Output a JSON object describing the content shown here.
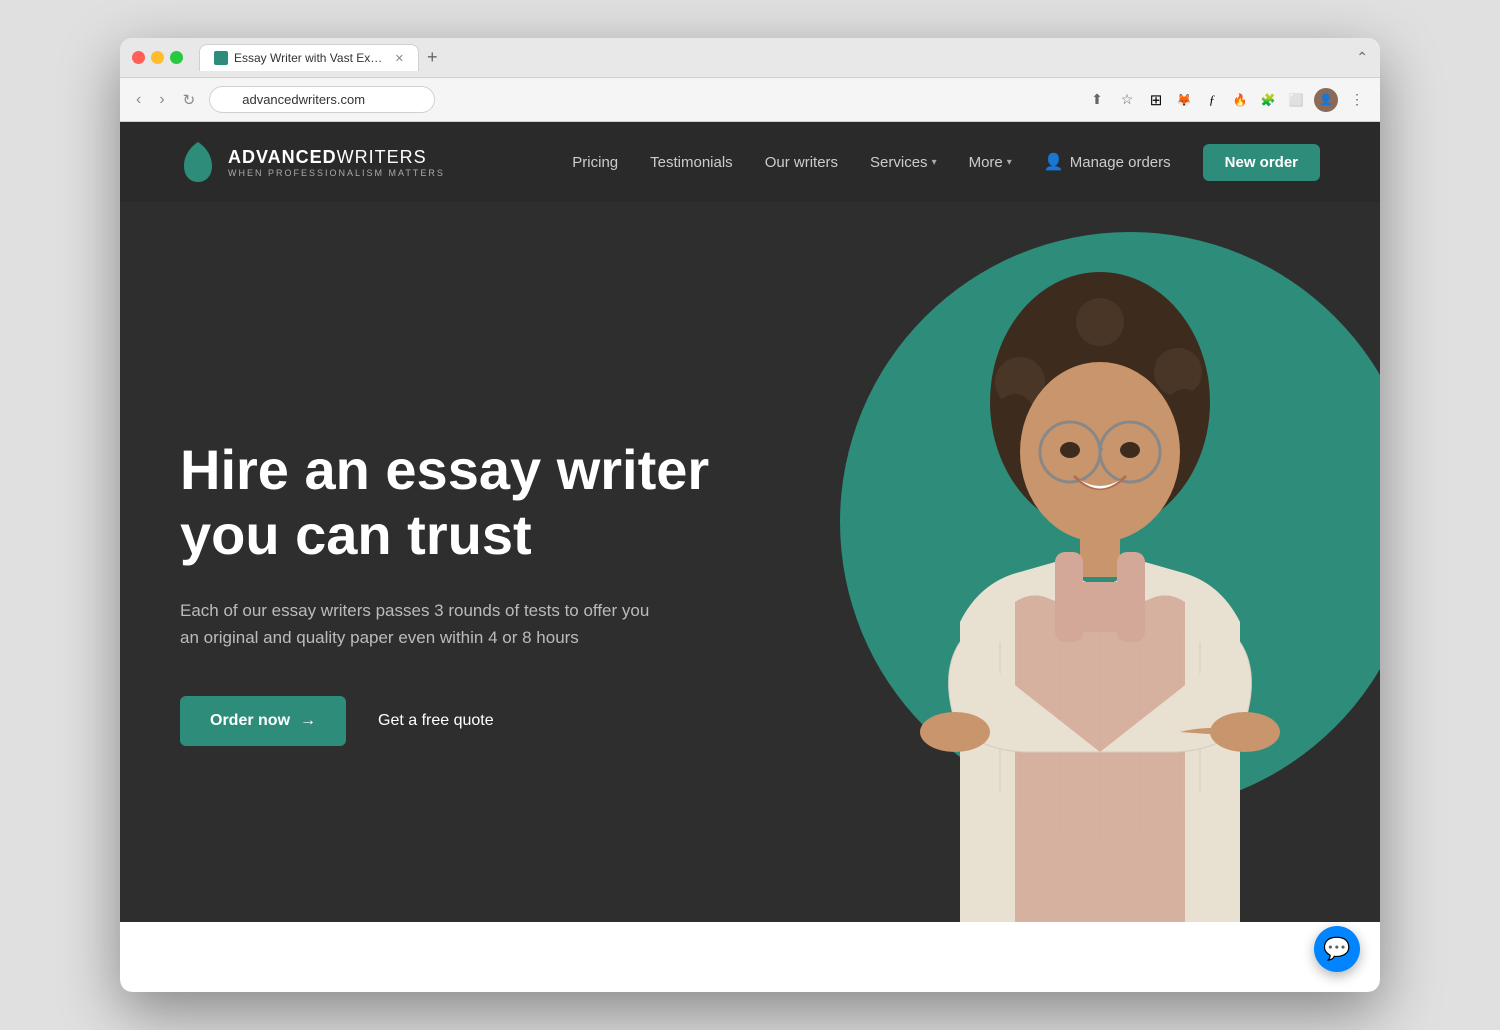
{
  "browser": {
    "tab_title": "Essay Writer with Vast Experie...",
    "url": "advancedwriters.com",
    "new_tab_label": "+",
    "back_label": "‹",
    "forward_label": "›",
    "reload_label": "↻",
    "window_collapse_label": "⌃"
  },
  "navbar": {
    "logo_main_bold": "ADVANCED",
    "logo_main_light": "WRITERS",
    "logo_tagline": "WHEN PROFESSIONALISM MATTERS",
    "nav_pricing": "Pricing",
    "nav_testimonials": "Testimonials",
    "nav_our_writers": "Our writers",
    "nav_services": "Services",
    "nav_more": "More",
    "nav_manage_orders": "Manage orders",
    "btn_new_order": "New order"
  },
  "hero": {
    "title_line1": "Hire an essay writer",
    "title_line2": "you can trust",
    "subtitle": "Each of our essay writers passes 3 rounds of tests to offer you an original and quality paper even within 4 or 8 hours",
    "btn_order_now": "Order now",
    "btn_arrow": "→",
    "btn_free_quote": "Get a free quote"
  },
  "colors": {
    "teal": "#2d8c7a",
    "dark_bg": "#2e2e2e",
    "darker_bg": "#2a2a2a",
    "white": "#ffffff",
    "text_muted": "#bbbbbb"
  }
}
